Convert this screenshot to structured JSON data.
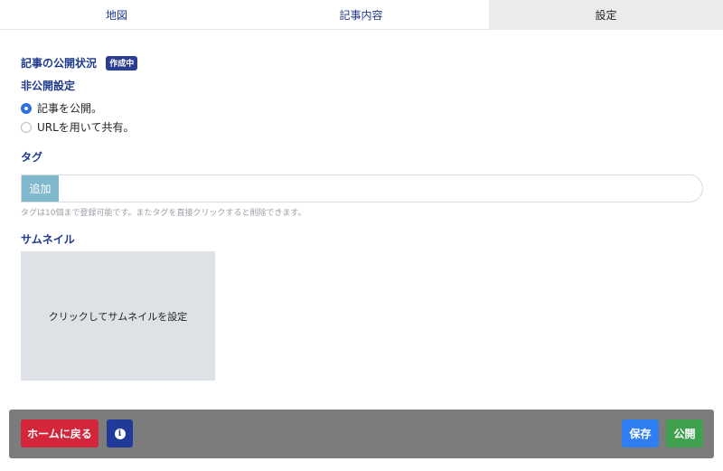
{
  "tabs": [
    {
      "label": "地図"
    },
    {
      "label": "記事内容"
    },
    {
      "label": "設定"
    }
  ],
  "publish_status": {
    "label": "記事の公開状況",
    "badge": "作成中",
    "badge_color": "#2b3d91"
  },
  "privacy": {
    "label": "非公開設定",
    "options": [
      {
        "label": "記事を公開。",
        "checked": true
      },
      {
        "label": "URLを用いて共有。",
        "checked": false
      }
    ]
  },
  "tags": {
    "label": "タグ",
    "add_label": "追加",
    "input_value": "",
    "help": "タグは10個まで登録可能です。またタグを直接クリックすると削除できます。"
  },
  "thumbnail": {
    "label": "サムネイル",
    "placeholder": "クリックしてサムネイルを設定"
  },
  "footer": {
    "home_label": "ホームに戻る",
    "info_icon": "i",
    "save_label": "保存",
    "publish_label": "公開"
  },
  "colors": {
    "accent": "#1f3a8a",
    "home": "#d3263a",
    "save": "#2f7ef2",
    "publish": "#3fa04e"
  }
}
